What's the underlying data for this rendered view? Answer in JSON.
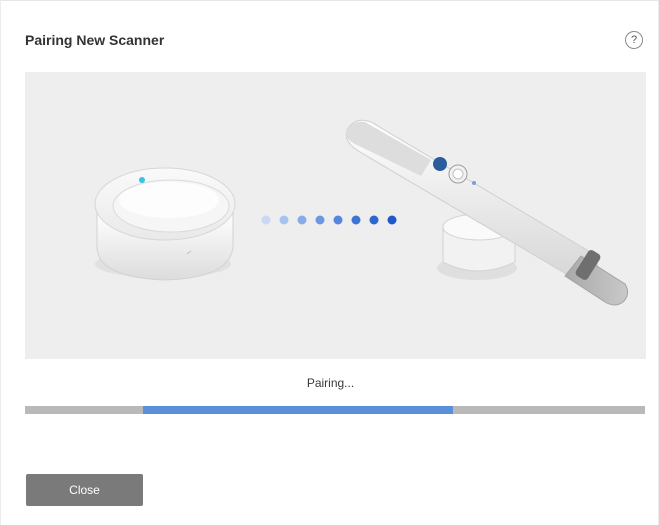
{
  "dialog": {
    "title": "Pairing New Scanner",
    "help_icon": "question-icon",
    "help_glyph": "?"
  },
  "illustration": {
    "left_device": "dongle-hub",
    "right_device": "intraoral-scanner",
    "indicator_color": "#35c3e8",
    "dot_colors": [
      "#c9d9f3",
      "#a7c2ee",
      "#88ace8",
      "#6c98e2",
      "#5586dc",
      "#3f74d6",
      "#2e66d0",
      "#1f59c9"
    ]
  },
  "status": {
    "text": "Pairing..."
  },
  "progress": {
    "start_fraction": 0.19,
    "end_fraction": 0.69
  },
  "footer": {
    "close_label": "Close"
  },
  "colors": {
    "accent": "#5b8fd9",
    "track": "#b9b9b9",
    "button": "#7a7a7a"
  }
}
